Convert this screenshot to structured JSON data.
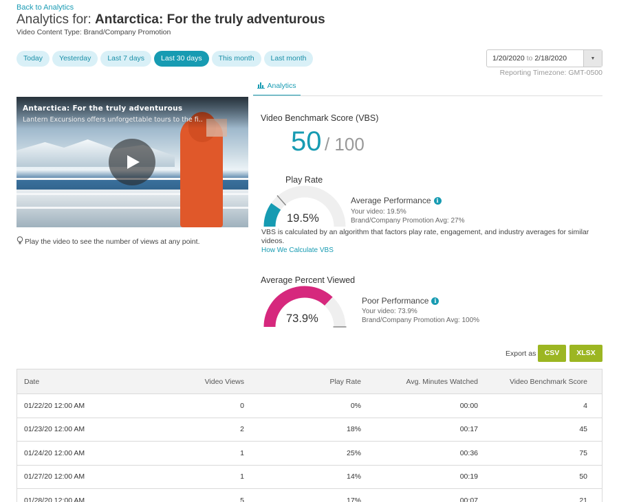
{
  "header": {
    "back_link": "Back to Analytics",
    "title_prefix": "Analytics for: ",
    "title_name": "Antarctica: For the truly adventurous",
    "content_type": "Video Content Type: Brand/Company Promotion"
  },
  "date_ranges": [
    {
      "label": "Today",
      "active": false
    },
    {
      "label": "Yesterday",
      "active": false
    },
    {
      "label": "Last 7 days",
      "active": false
    },
    {
      "label": "Last 30 days",
      "active": true
    },
    {
      "label": "This month",
      "active": false
    },
    {
      "label": "Last month",
      "active": false
    }
  ],
  "date_picker": {
    "start": "1/20/2020",
    "separator": "to",
    "end": "2/18/2020",
    "timezone": "Reporting Timezone: GMT-0500"
  },
  "tabs": {
    "analytics_label": "Analytics",
    "analytics_icon": "bar-chart-icon"
  },
  "video": {
    "title": "Antarctica: For the truly adventurous",
    "description": "Lantern Excursions offers unforgettable tours to the fi..",
    "hint": "Play the video to see the number of views at any point."
  },
  "vbs": {
    "title": "Video Benchmark Score (VBS)",
    "score": "50",
    "max": "/ 100",
    "explanation": "VBS is calculated by an algorithm that factors play rate, engagement, and industry averages for similar videos.",
    "link": "How We Calculate VBS"
  },
  "play_rate": {
    "title": "Play Rate",
    "value_text": "19.5%",
    "fraction": 0.195,
    "benchmark_fraction": 0.27,
    "performance": "Average Performance",
    "your_video": "Your video: 19.5%",
    "category_avg": "Brand/Company Promotion Avg: 27%"
  },
  "avg_percent_viewed": {
    "title": "Average Percent Viewed",
    "value_text": "73.9%",
    "fraction": 0.739,
    "benchmark_fraction": 1.0,
    "performance": "Poor Performance",
    "your_video": "Your video: 73.9%",
    "category_avg": "Brand/Company Promotion Avg: 100%"
  },
  "export": {
    "label": "Export as",
    "csv": "CSV",
    "xlsx": "XLSX"
  },
  "table": {
    "headers": [
      "Date",
      "Video Views",
      "Play Rate",
      "Avg. Minutes Watched",
      "Video Benchmark Score"
    ],
    "rows": [
      [
        "01/22/20 12:00 AM",
        "0",
        "0%",
        "00:00",
        "4"
      ],
      [
        "01/23/20 12:00 AM",
        "2",
        "18%",
        "00:17",
        "45"
      ],
      [
        "01/24/20 12:00 AM",
        "1",
        "25%",
        "00:36",
        "75"
      ],
      [
        "01/27/20 12:00 AM",
        "1",
        "14%",
        "00:19",
        "50"
      ],
      [
        "01/28/20 12:00 AM",
        "5",
        "17%",
        "00:07",
        "21"
      ]
    ]
  },
  "colors": {
    "accent": "#179bb2",
    "play_rate_arc": "#179bb2",
    "percent_viewed_arc": "#d6287d",
    "gauge_track": "#efefef",
    "export_button": "#9cb622"
  }
}
